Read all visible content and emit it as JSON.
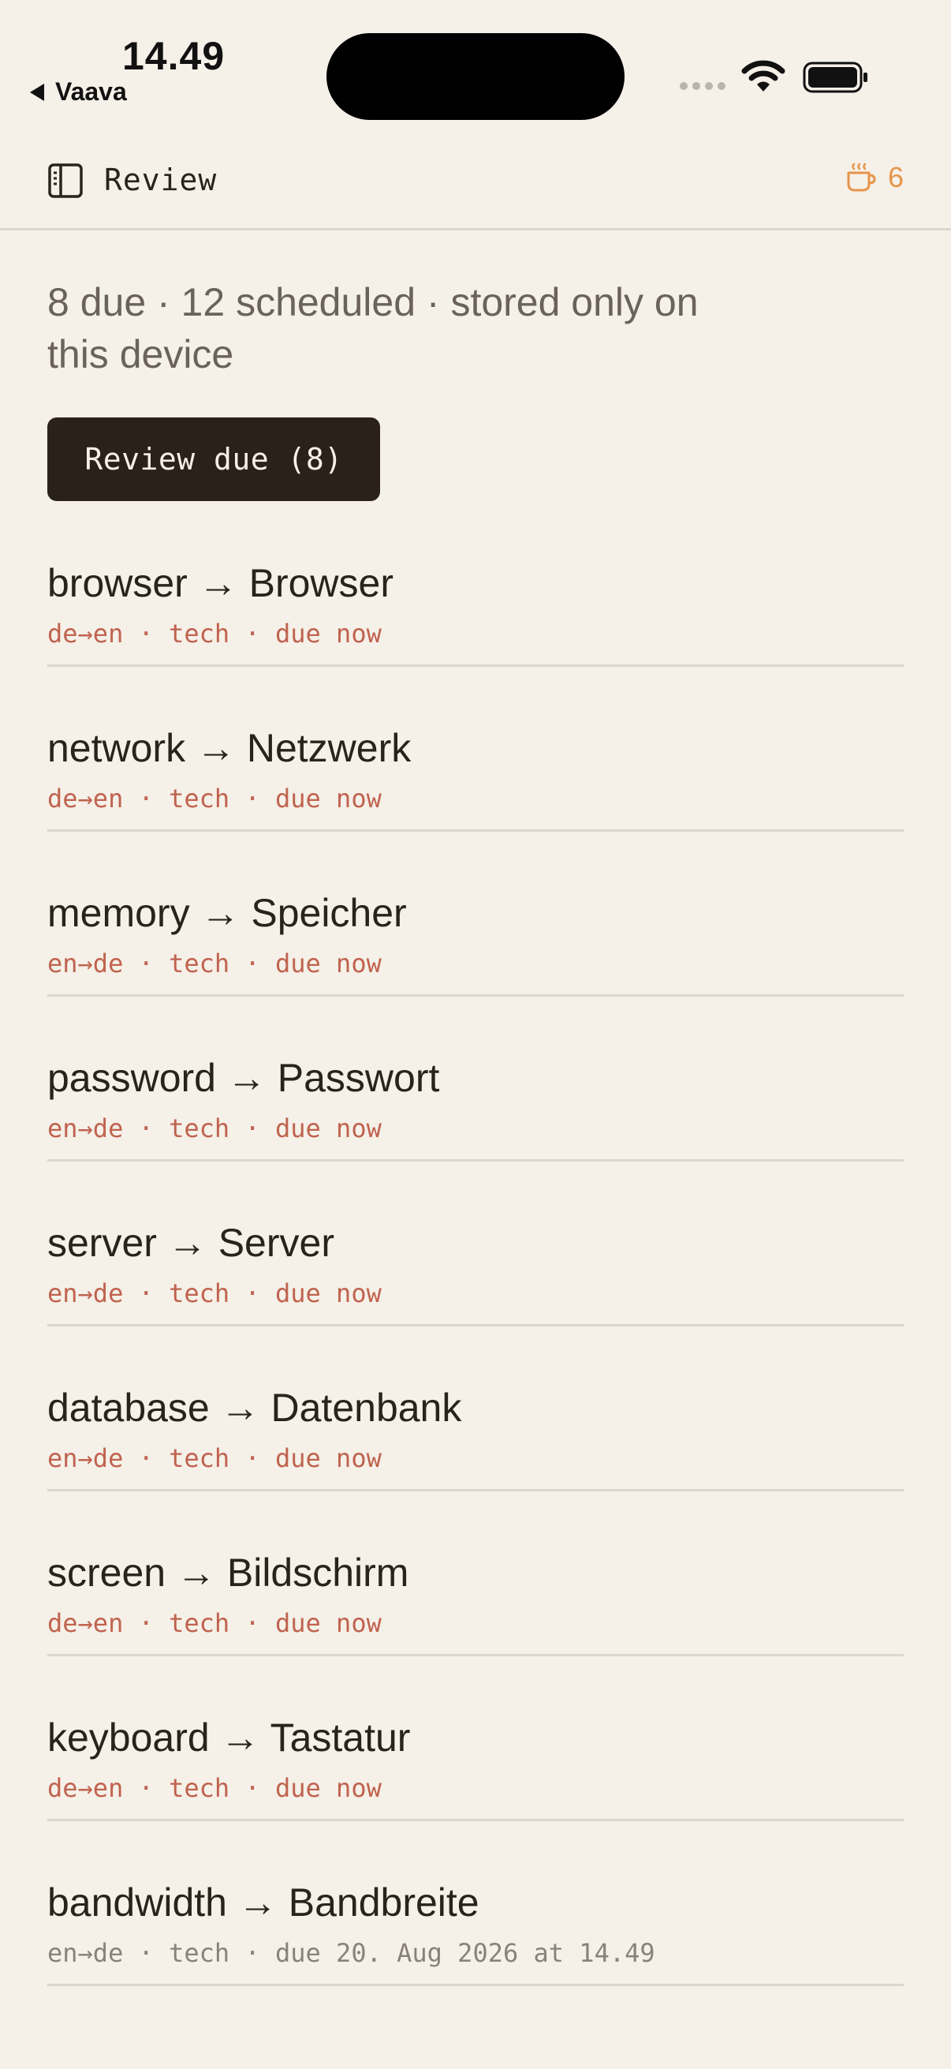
{
  "status_bar": {
    "time": "14.49",
    "back_app": "Vaava"
  },
  "nav": {
    "title": "Review",
    "streak_count": "6"
  },
  "summary": "8 due · 12 scheduled · stored only on this device",
  "review_button_label": "Review due (8)",
  "items": [
    {
      "term": "browser → Browser",
      "meta": "de→en · tech · due now"
    },
    {
      "term": "network → Netzwerk",
      "meta": "de→en · tech · due now"
    },
    {
      "term": "memory → Speicher",
      "meta": "en→de · tech · due now"
    },
    {
      "term": "password → Passwort",
      "meta": "en→de · tech · due now"
    },
    {
      "term": "server → Server",
      "meta": "en→de · tech · due now"
    },
    {
      "term": "database → Datenbank",
      "meta": "en→de · tech · due now"
    },
    {
      "term": "screen → Bildschirm",
      "meta": "de→en · tech · due now"
    },
    {
      "term": "keyboard → Tastatur",
      "meta": "de→en · tech · due now"
    },
    {
      "term": "bandwidth → Bandbreite",
      "meta": "en→de · tech · due 20. Aug 2026 at 14.49"
    }
  ],
  "colors": {
    "background": "#f5f0e8",
    "due_meta": "#c0634f",
    "scheduled_meta": "#8a827a",
    "accent_streak": "#e6954a",
    "button_bg": "#2a211a"
  }
}
